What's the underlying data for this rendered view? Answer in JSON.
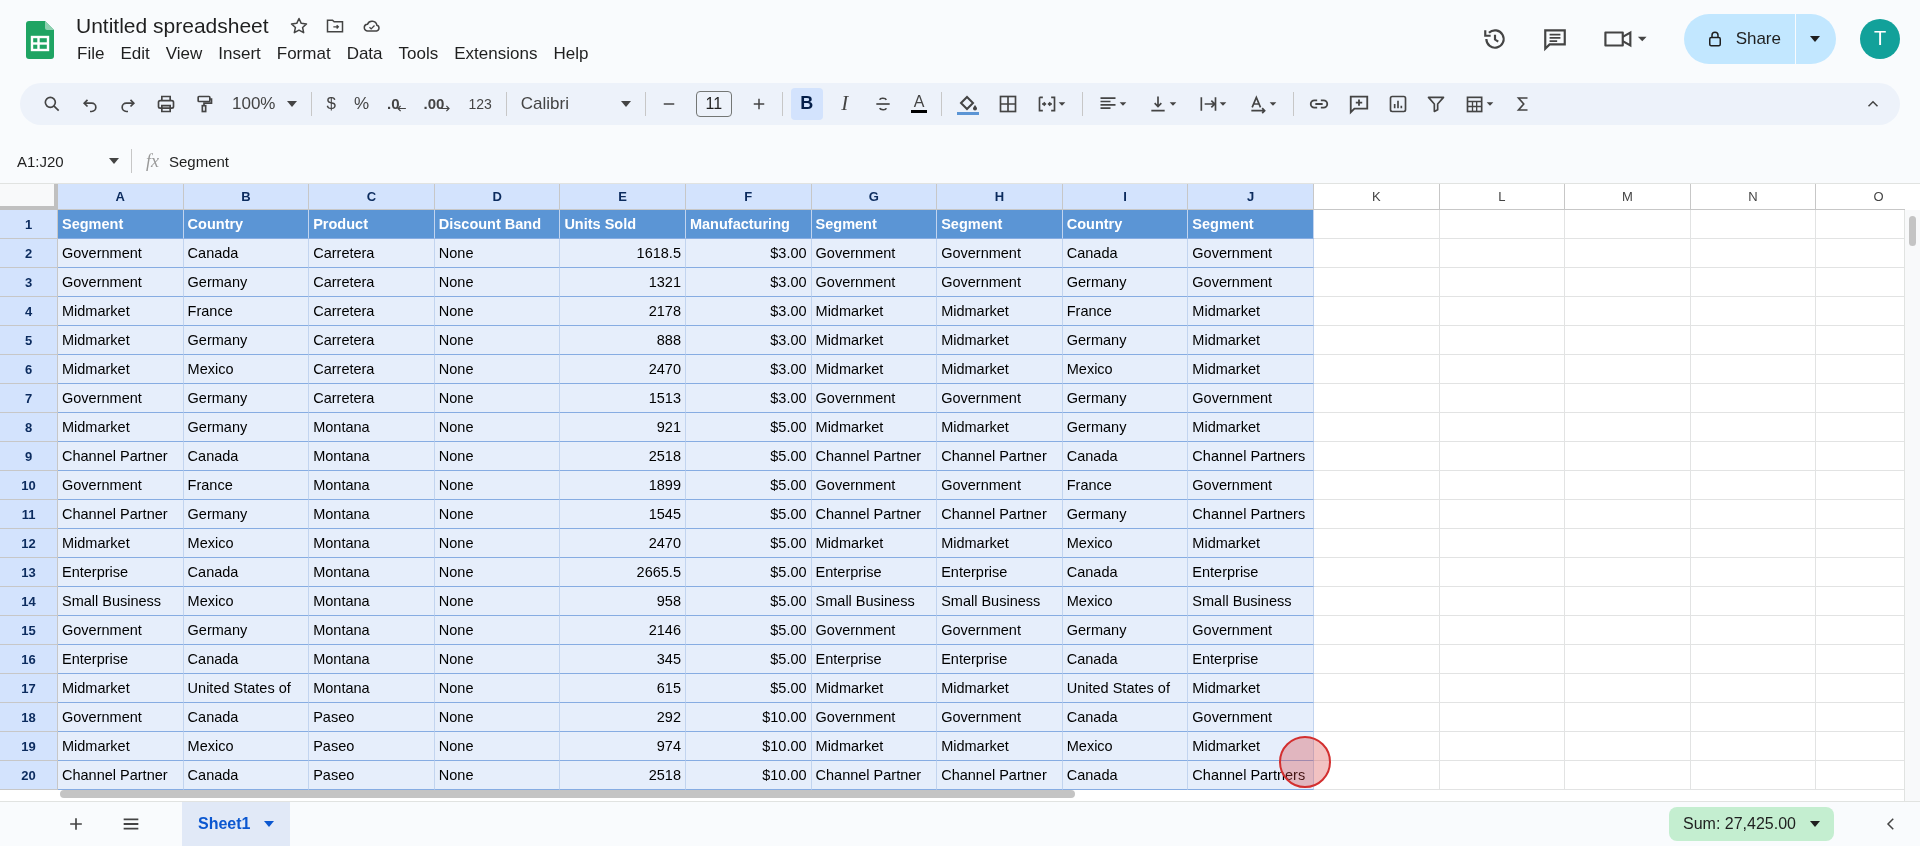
{
  "app": {
    "title": "Untitled spreadsheet",
    "menu": [
      "File",
      "Edit",
      "View",
      "Insert",
      "Format",
      "Data",
      "Tools",
      "Extensions",
      "Help"
    ],
    "share": "Share",
    "avatar": "T"
  },
  "toolbar": {
    "zoom": "100%",
    "currency": "$",
    "percent": "%",
    "decrease_decimal": ".0",
    "increase_decimal": ".00",
    "number_format": "123",
    "font": "Calibri",
    "font_size": "11",
    "bold": {
      "label": "B",
      "on": true
    },
    "italic": {
      "label": "I",
      "on": false
    },
    "text_color": "A"
  },
  "formula_bar": {
    "name_box": "A1:J20",
    "fx": "fx",
    "value": "Segment"
  },
  "grid": {
    "columns": [
      {
        "letter": "A",
        "selected": true,
        "kind": "text"
      },
      {
        "letter": "B",
        "selected": true,
        "kind": "text"
      },
      {
        "letter": "C",
        "selected": true,
        "kind": "text"
      },
      {
        "letter": "D",
        "selected": true,
        "kind": "text"
      },
      {
        "letter": "E",
        "selected": true,
        "kind": "number"
      },
      {
        "letter": "F",
        "selected": true,
        "kind": "number"
      },
      {
        "letter": "G",
        "selected": true,
        "kind": "text"
      },
      {
        "letter": "H",
        "selected": true,
        "kind": "text"
      },
      {
        "letter": "I",
        "selected": true,
        "kind": "text"
      },
      {
        "letter": "J",
        "selected": true,
        "kind": "text"
      },
      {
        "letter": "K",
        "selected": false
      },
      {
        "letter": "L",
        "selected": false
      },
      {
        "letter": "M",
        "selected": false
      },
      {
        "letter": "N",
        "selected": false
      },
      {
        "letter": "O",
        "selected": false
      }
    ],
    "rows": [
      {
        "number": "1",
        "selected": true,
        "kind": "header",
        "cells": [
          "Segment",
          "Country",
          "Product",
          "Discount Band",
          "Units Sold",
          "Manufacturing",
          "Segment",
          "Segment",
          "Country",
          "Segment"
        ]
      },
      {
        "number": "2",
        "selected": true,
        "kind": "data",
        "cells": [
          "Government",
          "Canada",
          "Carretera",
          "None",
          "1618.5",
          "$3.00",
          "Government",
          "Government",
          "Canada",
          "Government"
        ]
      },
      {
        "number": "3",
        "selected": true,
        "kind": "data",
        "cells": [
          "Government",
          "Germany",
          "Carretera",
          "None",
          "1321",
          "$3.00",
          "Government",
          "Government",
          "Germany",
          "Government"
        ]
      },
      {
        "number": "4",
        "selected": true,
        "kind": "data",
        "cells": [
          "Midmarket",
          "France",
          "Carretera",
          "None",
          "2178",
          "$3.00",
          "Midmarket",
          "Midmarket",
          "France",
          "Midmarket"
        ]
      },
      {
        "number": "5",
        "selected": true,
        "kind": "data",
        "cells": [
          "Midmarket",
          "Germany",
          "Carretera",
          "None",
          "888",
          "$3.00",
          "Midmarket",
          "Midmarket",
          "Germany",
          "Midmarket"
        ]
      },
      {
        "number": "6",
        "selected": true,
        "kind": "data",
        "cells": [
          "Midmarket",
          "Mexico",
          "Carretera",
          "None",
          "2470",
          "$3.00",
          "Midmarket",
          "Midmarket",
          "Mexico",
          "Midmarket"
        ]
      },
      {
        "number": "7",
        "selected": true,
        "kind": "data",
        "cells": [
          "Government",
          "Germany",
          "Carretera",
          "None",
          "1513",
          "$3.00",
          "Government",
          "Government",
          "Germany",
          "Government"
        ]
      },
      {
        "number": "8",
        "selected": true,
        "kind": "data",
        "cells": [
          "Midmarket",
          "Germany",
          "Montana",
          "None",
          "921",
          "$5.00",
          "Midmarket",
          "Midmarket",
          "Germany",
          "Midmarket"
        ]
      },
      {
        "number": "9",
        "selected": true,
        "kind": "data",
        "cells": [
          "Channel Partner",
          "Canada",
          "Montana",
          "None",
          "2518",
          "$5.00",
          "Channel Partner",
          "Channel Partner",
          "Canada",
          "Channel Partners"
        ]
      },
      {
        "number": "10",
        "selected": true,
        "kind": "data",
        "cells": [
          "Government",
          "France",
          "Montana",
          "None",
          "1899",
          "$5.00",
          "Government",
          "Government",
          "France",
          "Government"
        ]
      },
      {
        "number": "11",
        "selected": true,
        "kind": "data",
        "cells": [
          "Channel Partner",
          "Germany",
          "Montana",
          "None",
          "1545",
          "$5.00",
          "Channel Partner",
          "Channel Partner",
          "Germany",
          "Channel Partners"
        ]
      },
      {
        "number": "12",
        "selected": true,
        "kind": "data",
        "cells": [
          "Midmarket",
          "Mexico",
          "Montana",
          "None",
          "2470",
          "$5.00",
          "Midmarket",
          "Midmarket",
          "Mexico",
          "Midmarket"
        ]
      },
      {
        "number": "13",
        "selected": true,
        "kind": "data",
        "cells": [
          "Enterprise",
          "Canada",
          "Montana",
          "None",
          "2665.5",
          "$5.00",
          "Enterprise",
          "Enterprise",
          "Canada",
          "Enterprise"
        ]
      },
      {
        "number": "14",
        "selected": true,
        "kind": "data",
        "cells": [
          "Small Business",
          "Mexico",
          "Montana",
          "None",
          "958",
          "$5.00",
          "Small Business",
          "Small Business",
          "Mexico",
          "Small Business"
        ]
      },
      {
        "number": "15",
        "selected": true,
        "kind": "data",
        "cells": [
          "Government",
          "Germany",
          "Montana",
          "None",
          "2146",
          "$5.00",
          "Government",
          "Government",
          "Germany",
          "Government"
        ]
      },
      {
        "number": "16",
        "selected": true,
        "kind": "data",
        "cells": [
          "Enterprise",
          "Canada",
          "Montana",
          "None",
          "345",
          "$5.00",
          "Enterprise",
          "Enterprise",
          "Canada",
          "Enterprise"
        ]
      },
      {
        "number": "17",
        "selected": true,
        "kind": "data",
        "cells": [
          "Midmarket",
          "United States of",
          "Montana",
          "None",
          "615",
          "$5.00",
          "Midmarket",
          "Midmarket",
          "United States of",
          "Midmarket"
        ]
      },
      {
        "number": "18",
        "selected": true,
        "kind": "data",
        "cells": [
          "Government",
          "Canada",
          "Paseo",
          "None",
          "292",
          "$10.00",
          "Government",
          "Government",
          "Canada",
          "Government"
        ]
      },
      {
        "number": "19",
        "selected": true,
        "kind": "data",
        "cells": [
          "Midmarket",
          "Mexico",
          "Paseo",
          "None",
          "974",
          "$10.00",
          "Midmarket",
          "Midmarket",
          "Mexico",
          "Midmarket"
        ]
      },
      {
        "number": "20",
        "selected": true,
        "kind": "data",
        "cells": [
          "Channel Partner",
          "Canada",
          "Paseo",
          "None",
          "2518",
          "$10.00",
          "Channel Partner",
          "Channel Partner",
          "Canada",
          "Channel Partners"
        ]
      }
    ]
  },
  "sheet_tabs": [
    {
      "label": "Sheet1",
      "selected": true
    }
  ],
  "status": {
    "sum": "Sum: 27,425.00"
  }
}
